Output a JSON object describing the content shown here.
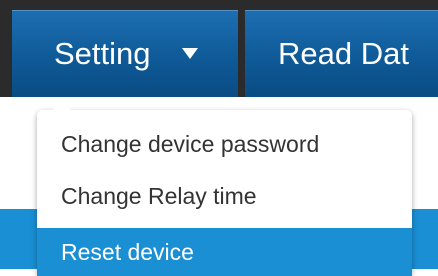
{
  "nav": {
    "setting_label": "Setting",
    "read_label": "Read Dat"
  },
  "dropdown": {
    "items": [
      {
        "label": "Change device password",
        "highlighted": false
      },
      {
        "label": "Change Relay time",
        "highlighted": false
      },
      {
        "label": "Reset device",
        "highlighted": true
      }
    ]
  },
  "icons": {
    "setting_caret": "caret-down-icon"
  },
  "colors": {
    "bar_bg": "#2b2b2b",
    "button_blue": "#0f5a98",
    "highlight": "#1a8fd4",
    "menu_text": "#333333",
    "menu_bg": "#ffffff"
  }
}
